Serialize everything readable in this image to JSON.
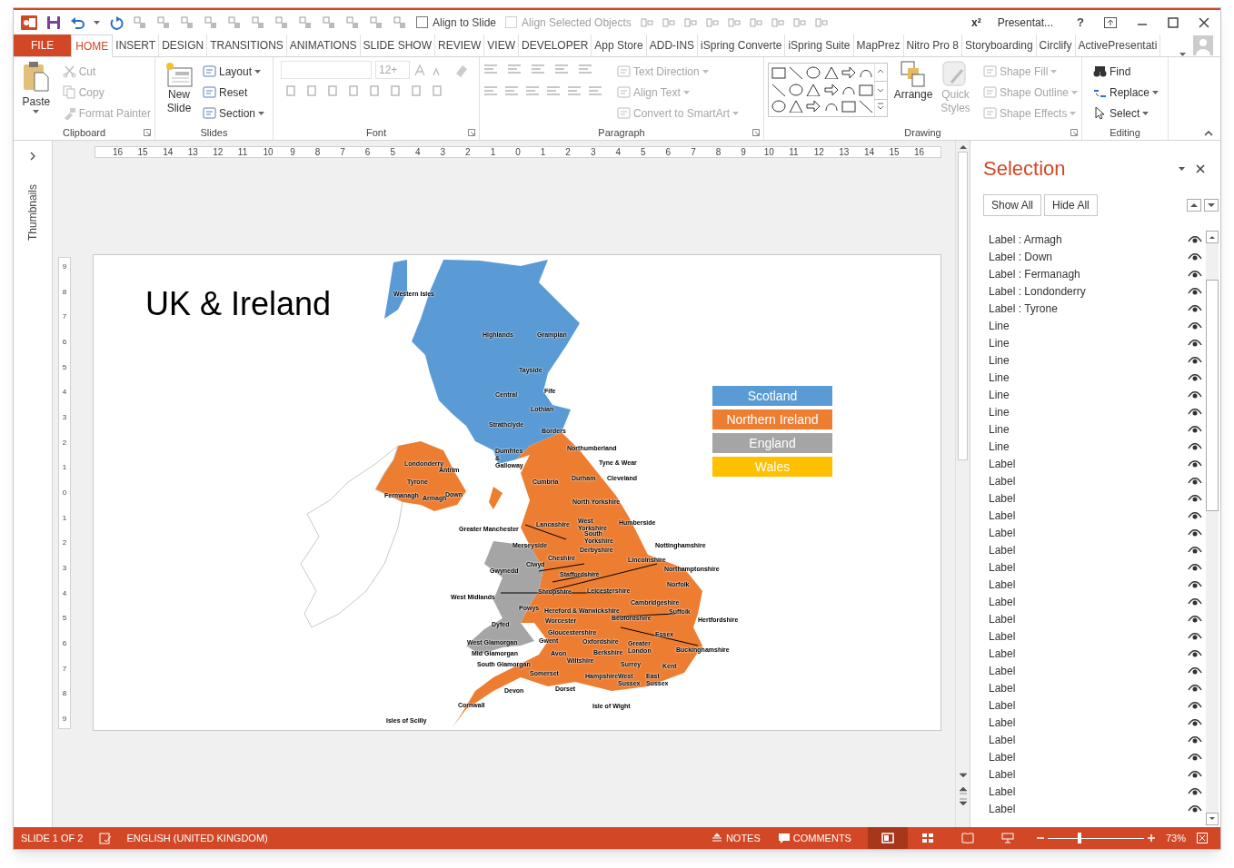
{
  "title_bar": {
    "title": "Presentat...",
    "help": "?",
    "superscript": "x²",
    "checkboxes": [
      {
        "label": "Align to Slide",
        "checked": false,
        "disabled": false
      },
      {
        "label": "Align Selected Objects",
        "checked": false,
        "disabled": true
      }
    ]
  },
  "tabs": [
    {
      "label": "FILE",
      "kind": "file",
      "selected": false
    },
    {
      "label": "HOME",
      "kind": "tab",
      "selected": true
    },
    {
      "label": "INSERT",
      "kind": "tab",
      "selected": false
    },
    {
      "label": "DESIGN",
      "kind": "tab",
      "selected": false
    },
    {
      "label": "TRANSITIONS",
      "kind": "tab",
      "selected": false
    },
    {
      "label": "ANIMATIONS",
      "kind": "tab",
      "selected": false
    },
    {
      "label": "SLIDE SHOW",
      "kind": "tab",
      "selected": false
    },
    {
      "label": "REVIEW",
      "kind": "tab",
      "selected": false
    },
    {
      "label": "VIEW",
      "kind": "tab",
      "selected": false
    },
    {
      "label": "DEVELOPER",
      "kind": "tab",
      "selected": false
    },
    {
      "label": "App Store",
      "kind": "tab",
      "selected": false
    },
    {
      "label": "ADD-INS",
      "kind": "tab",
      "selected": false
    },
    {
      "label": "iSpring Converte",
      "kind": "tab",
      "selected": false
    },
    {
      "label": "iSpring Suite",
      "kind": "tab",
      "selected": false
    },
    {
      "label": "MapPrez",
      "kind": "tab",
      "selected": false
    },
    {
      "label": "Nitro Pro 8",
      "kind": "tab",
      "selected": false
    },
    {
      "label": "Storyboarding",
      "kind": "tab",
      "selected": false
    },
    {
      "label": "Circlify",
      "kind": "tab",
      "selected": false
    },
    {
      "label": "ActivePresentati",
      "kind": "tab",
      "selected": false
    }
  ],
  "ribbon": {
    "clipboard": {
      "label": "Clipboard",
      "paste": {
        "label": "Paste",
        "disabled": false
      },
      "items": [
        {
          "label": "Cut",
          "disabled": true
        },
        {
          "label": "Copy",
          "disabled": true
        },
        {
          "label": "Format Painter",
          "disabled": true
        }
      ]
    },
    "slides": {
      "label": "Slides",
      "new_slide": {
        "label": "New Slide",
        "disabled": false
      },
      "items": [
        {
          "label": "Layout",
          "disabled": false
        },
        {
          "label": "Reset",
          "disabled": false
        },
        {
          "label": "Section",
          "disabled": false
        }
      ]
    },
    "font": {
      "label": "Font",
      "font_size": "12+"
    },
    "paragraph": {
      "label": "Paragraph",
      "items": [
        {
          "label": "Text Direction",
          "disabled": true
        },
        {
          "label": "Align Text",
          "disabled": true
        },
        {
          "label": "Convert to SmartArt",
          "disabled": true
        }
      ]
    },
    "drawing": {
      "label": "Drawing",
      "large": [
        {
          "label": "Arrange",
          "disabled": false
        },
        {
          "label": "Quick Styles",
          "disabled": true
        }
      ],
      "items": [
        {
          "label": "Shape Fill",
          "disabled": true
        },
        {
          "label": "Shape Outline",
          "disabled": true
        },
        {
          "label": "Shape Effects",
          "disabled": true
        }
      ]
    },
    "editing": {
      "label": "Editing",
      "items": [
        {
          "label": "Find",
          "disabled": false
        },
        {
          "label": "Replace",
          "disabled": false
        },
        {
          "label": "Select",
          "disabled": false
        }
      ]
    }
  },
  "thumbnails": {
    "label": "Thumbnails"
  },
  "ruler_h": [
    "16",
    "15",
    "14",
    "13",
    "12",
    "11",
    "10",
    "9",
    "8",
    "7",
    "6",
    "5",
    "4",
    "3",
    "2",
    "1",
    "0",
    "1",
    "2",
    "3",
    "4",
    "5",
    "6",
    "7",
    "8",
    "9",
    "10",
    "11",
    "12",
    "13",
    "14",
    "15",
    "16"
  ],
  "ruler_v": [
    "9",
    "8",
    "7",
    "6",
    "5",
    "4",
    "3",
    "2",
    "1",
    "0",
    "1",
    "2",
    "3",
    "4",
    "5",
    "6",
    "7",
    "8",
    "9"
  ],
  "slide": {
    "title": "UK & Ireland",
    "legend": [
      {
        "label": "Scotland",
        "color": "#5b9bd5"
      },
      {
        "label": "Northern Ireland",
        "color": "#ed7d31"
      },
      {
        "label": "England",
        "color": "#a5a5a5"
      },
      {
        "label": "Wales",
        "color": "#ffc000"
      }
    ],
    "map_labels": [
      "Western Isles",
      "Highlands",
      "Grampian",
      "Tayside",
      "Fife",
      "Central",
      "Lothian",
      "Strathclyde",
      "Borders",
      "Londonderry",
      "Dumfries & Galloway",
      "Antrim",
      "Tyrone",
      "Fermanagh",
      "Armagh",
      "Down",
      "Northumberland",
      "Tyne & Wear",
      "Durham",
      "Cleveland",
      "Cumbria",
      "North Yorkshire",
      "Lancashire",
      "West Yorkshire",
      "Humberside",
      "Greater Manchester",
      "South Yorkshire",
      "Merseyside",
      "Nottinghamshire",
      "Cheshire",
      "Derbyshire",
      "Lincolnshire",
      "Northamptonshire",
      "Clwyd",
      "Gwynedd",
      "Staffordshire",
      "Norfolk",
      "Shropshire",
      "Leicestershire",
      "West Midlands",
      "Cambridgeshire",
      "Powys",
      "Hereford & Warwickshire",
      "Suffolk",
      "Bedfordshire",
      "Worcester",
      "Hertfordshire",
      "Dyfed",
      "Gloucestershire",
      "Essex",
      "Gwent",
      "West Glamorgan",
      "Oxfordshire",
      "Greater London",
      "Buckinghamshire",
      "Mid Glamorgan",
      "Avon",
      "Berkshire",
      "South Glamorgan",
      "Wiltshire",
      "Surrey",
      "Kent",
      "Somerset",
      "Hampshire",
      "West Sussex",
      "East Sussex",
      "Devon",
      "Dorset",
      "Isle of Wight",
      "Cornwall",
      "Isles of Scilly"
    ]
  },
  "selection_pane": {
    "title": "Selection",
    "buttons": [
      "Show All",
      "Hide All"
    ],
    "items": [
      {
        "label": "Label : Armagh",
        "visible": true
      },
      {
        "label": "Label : Down",
        "visible": true
      },
      {
        "label": "Label : Fermanagh",
        "visible": true
      },
      {
        "label": "Label : Londonderry",
        "visible": true
      },
      {
        "label": "Label : Tyrone",
        "visible": true
      },
      {
        "label": "Line",
        "visible": true
      },
      {
        "label": "Line",
        "visible": true
      },
      {
        "label": "Line",
        "visible": true
      },
      {
        "label": "Line",
        "visible": true
      },
      {
        "label": "Line",
        "visible": true
      },
      {
        "label": "Line",
        "visible": true
      },
      {
        "label": "Line",
        "visible": true
      },
      {
        "label": "Line",
        "visible": true
      },
      {
        "label": "Label",
        "visible": true
      },
      {
        "label": "Label",
        "visible": true
      },
      {
        "label": "Label",
        "visible": true
      },
      {
        "label": "Label",
        "visible": true
      },
      {
        "label": "Label",
        "visible": true
      },
      {
        "label": "Label",
        "visible": true
      },
      {
        "label": "Label",
        "visible": true
      },
      {
        "label": "Label",
        "visible": true
      },
      {
        "label": "Label",
        "visible": true
      },
      {
        "label": "Label",
        "visible": true
      },
      {
        "label": "Label",
        "visible": true
      },
      {
        "label": "Label",
        "visible": true
      },
      {
        "label": "Label",
        "visible": true
      },
      {
        "label": "Label",
        "visible": true
      },
      {
        "label": "Label",
        "visible": true
      },
      {
        "label": "Label",
        "visible": true
      },
      {
        "label": "Label",
        "visible": true
      },
      {
        "label": "Label",
        "visible": true
      },
      {
        "label": "Label",
        "visible": true
      },
      {
        "label": "Label",
        "visible": true
      },
      {
        "label": "Label",
        "visible": true
      }
    ]
  },
  "status_bar": {
    "slide": "SLIDE 1 OF 2",
    "language": "ENGLISH (UNITED KINGDOM)",
    "notes": "NOTES",
    "comments": "COMMENTS",
    "views": [
      {
        "selected": true
      },
      {
        "selected": false
      },
      {
        "selected": false
      },
      {
        "selected": false
      }
    ],
    "zoom": {
      "level": 0.33,
      "reading": "73%"
    }
  }
}
